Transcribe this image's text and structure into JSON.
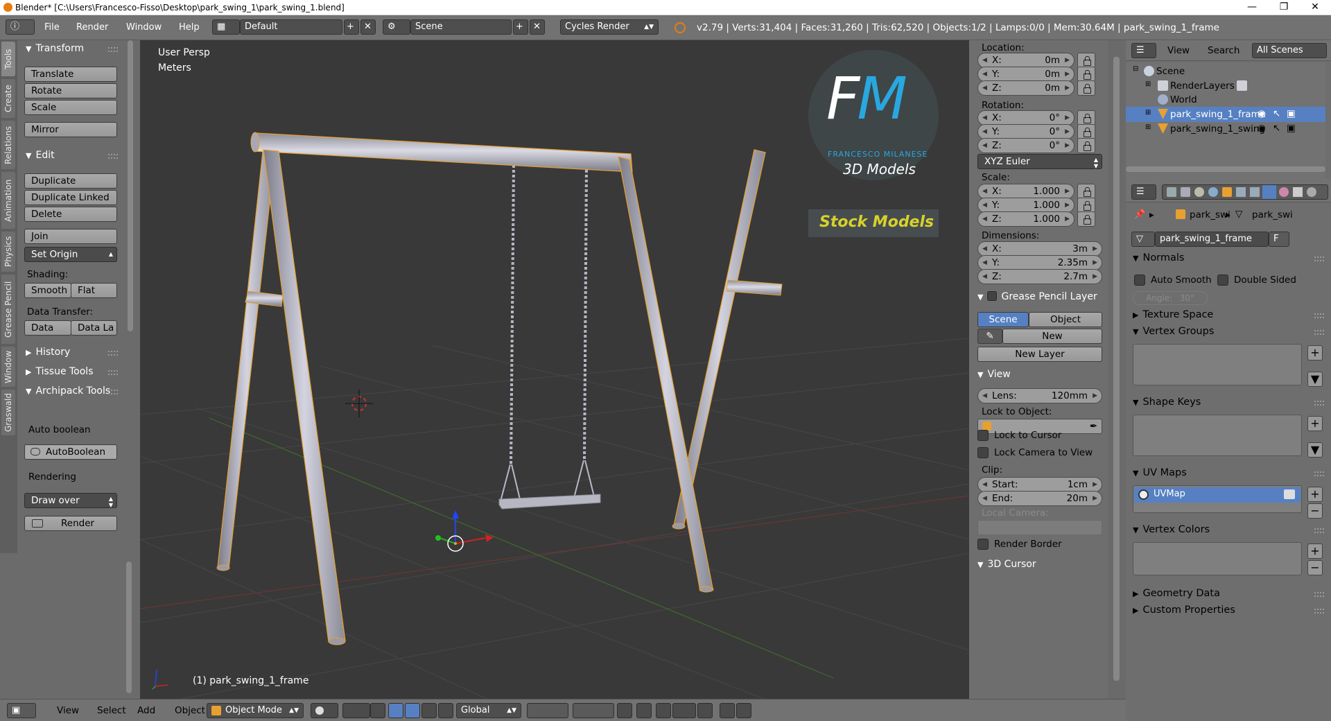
{
  "title_bar": {
    "title": "Blender* [C:\\Users\\Francesco-Fisso\\Desktop\\park_swing_1\\park_swing_1.blend]"
  },
  "info_header": {
    "menus": [
      "File",
      "Render",
      "Window",
      "Help"
    ],
    "layout": "Default",
    "scene": "Scene",
    "engine": "Cycles Render",
    "stats": "v2.79 | Verts:31,404 | Faces:31,260 | Tris:62,520 | Objects:1/2 | Lamps:0/0 | Mem:30.64M | park_swing_1_frame"
  },
  "tabs": [
    "Tools",
    "Create",
    "Relations",
    "Animation",
    "Physics",
    "Grease Pencil",
    "Window",
    "Graswald"
  ],
  "tool_shelf": {
    "transform_header": "Transform",
    "translate": "Translate",
    "rotate": "Rotate",
    "scale": "Scale",
    "mirror": "Mirror",
    "edit_header": "Edit",
    "duplicate": "Duplicate",
    "duplicate_linked": "Duplicate Linked",
    "delete": "Delete",
    "join": "Join",
    "set_origin": "Set Origin",
    "shading_label": "Shading:",
    "smooth": "Smooth",
    "flat": "Flat",
    "data_transfer_label": "Data Transfer:",
    "data": "Data",
    "data_la": "Data La",
    "history": "History",
    "tissue_tools": "Tissue Tools",
    "archipack_tools": "Archipack Tools",
    "auto_boolean_label": "Auto boolean",
    "autoboolean_btn": "AutoBoolean",
    "rendering_label": "Rendering",
    "draw_over": "Draw over",
    "render_btn": "Render"
  },
  "viewport": {
    "view_name": "User Persp",
    "units": "Meters",
    "object_label": "(1) park_swing_1_frame",
    "watermark_letters": "FM",
    "watermark_name": "FRANCESCO MILANESE",
    "watermark_sub": "3D Models",
    "watermark_tag": "Stock Models"
  },
  "n_panel": {
    "location_label": "Location:",
    "location": [
      {
        "k": "X:",
        "v": "0m"
      },
      {
        "k": "Y:",
        "v": "0m"
      },
      {
        "k": "Z:",
        "v": "0m"
      }
    ],
    "rotation_label": "Rotation:",
    "rotation": [
      {
        "k": "X:",
        "v": "0°"
      },
      {
        "k": "Y:",
        "v": "0°"
      },
      {
        "k": "Z:",
        "v": "0°"
      }
    ],
    "rotation_mode": "XYZ Euler",
    "scale_label": "Scale:",
    "scale": [
      {
        "k": "X:",
        "v": "1.000"
      },
      {
        "k": "Y:",
        "v": "1.000"
      },
      {
        "k": "Z:",
        "v": "1.000"
      }
    ],
    "dimensions_label": "Dimensions:",
    "dimensions": [
      {
        "k": "X:",
        "v": "3m"
      },
      {
        "k": "Y:",
        "v": "2.35m"
      },
      {
        "k": "Z:",
        "v": "2.7m"
      }
    ],
    "grease_pencil_header": "Grease Pencil Layer",
    "gp_scene": "Scene",
    "gp_object": "Object",
    "gp_new": "New",
    "gp_new_layer": "New Layer",
    "view_header": "View",
    "lens_k": "Lens:",
    "lens_v": "120mm",
    "lock_to_object": "Lock to Object:",
    "lock_to_cursor": "Lock to Cursor",
    "lock_camera": "Lock Camera to View",
    "clip_label": "Clip:",
    "clip_start_k": "Start:",
    "clip_start_v": "1cm",
    "clip_end_k": "End:",
    "clip_end_v": "20m",
    "local_camera": "Local Camera:",
    "render_border": "Render Border",
    "cursor_header": "3D Cursor"
  },
  "outliner": {
    "view": "View",
    "search": "Search",
    "all_scenes": "All Scenes",
    "scene": "Scene",
    "render_layers": "RenderLayers",
    "world": "World",
    "obj1": "park_swing_1_frame",
    "obj2": "park_swing_1_swing"
  },
  "properties": {
    "crumb_obj": "park_swi",
    "crumb_mesh": "park_swi",
    "mesh_name": "park_swing_1_frame",
    "fake_user": "F",
    "normals": "Normals",
    "auto_smooth": "Auto Smooth",
    "double_sided": "Double Sided",
    "angle_k": "Angle:",
    "angle_v": "30°",
    "texture_space": "Texture Space",
    "vertex_groups": "Vertex Groups",
    "shape_keys": "Shape Keys",
    "uv_maps": "UV Maps",
    "uvmap_item": "UVMap",
    "vertex_colors": "Vertex Colors",
    "geometry_data": "Geometry Data",
    "custom_properties": "Custom Properties"
  },
  "bottom_bar": {
    "view": "View",
    "select": "Select",
    "add": "Add",
    "object": "Object",
    "mode": "Object Mode",
    "orientation": "Global"
  },
  "colors": {
    "viewport_bg": "#393939",
    "panel_bg": "#6e6e6e",
    "selection_blue": "#5680c2",
    "watermark_blue": "#29a8e0",
    "watermark_yellow": "#d8d22a",
    "object_outline": "#f0a030"
  }
}
